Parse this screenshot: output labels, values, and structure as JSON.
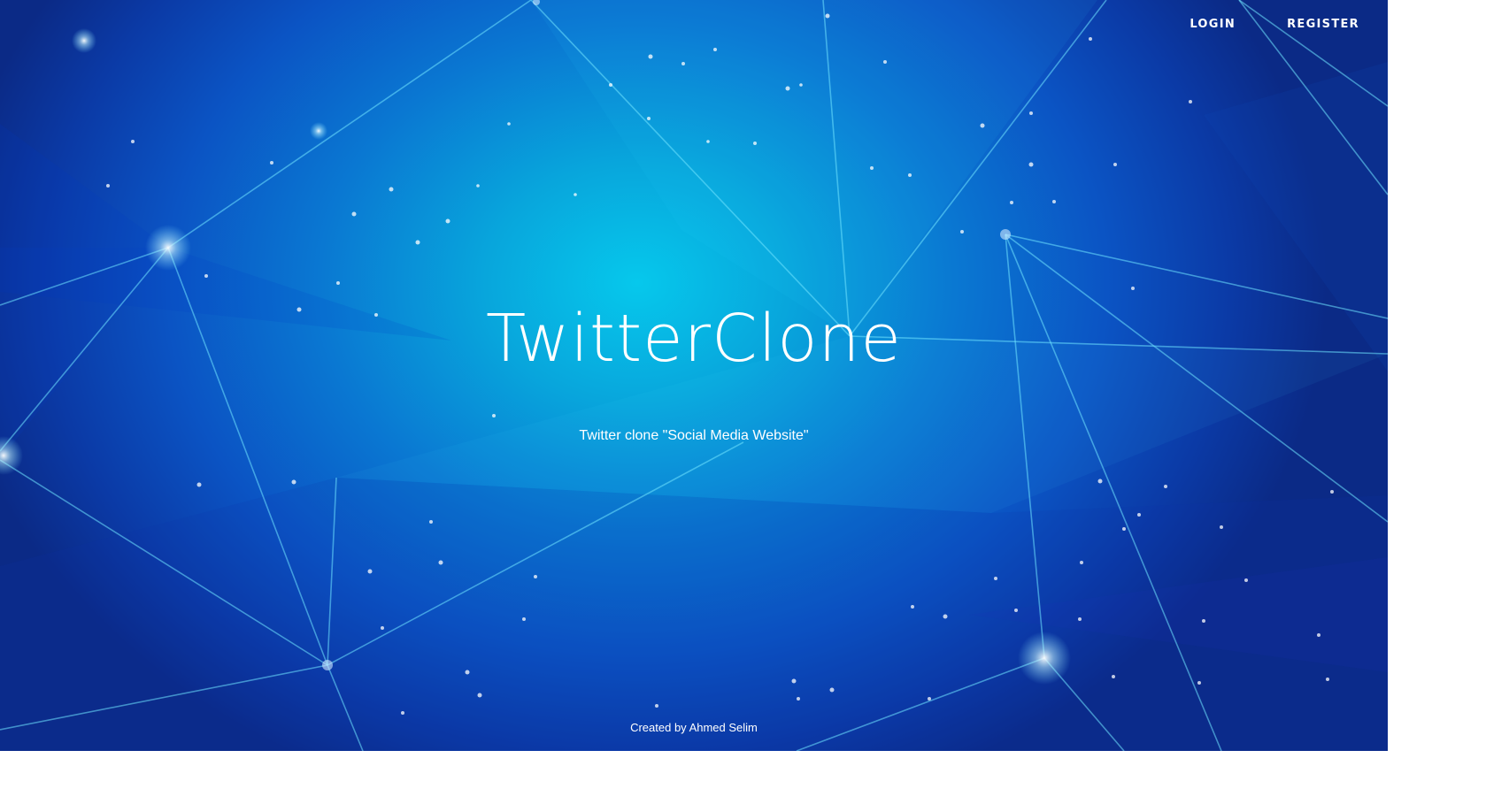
{
  "nav": {
    "login_label": "LOGIN",
    "register_label": "REGISTER"
  },
  "hero": {
    "title": "TwitterClone",
    "tagline": "Twitter clone \"Social Media Website\""
  },
  "footer": {
    "credit": "Created by Ahmed Selim"
  },
  "colors": {
    "background_center": "#06c8ec",
    "background_edge": "#0b2a86",
    "text": "#ffffff",
    "network_line": "#6fe3ff"
  }
}
